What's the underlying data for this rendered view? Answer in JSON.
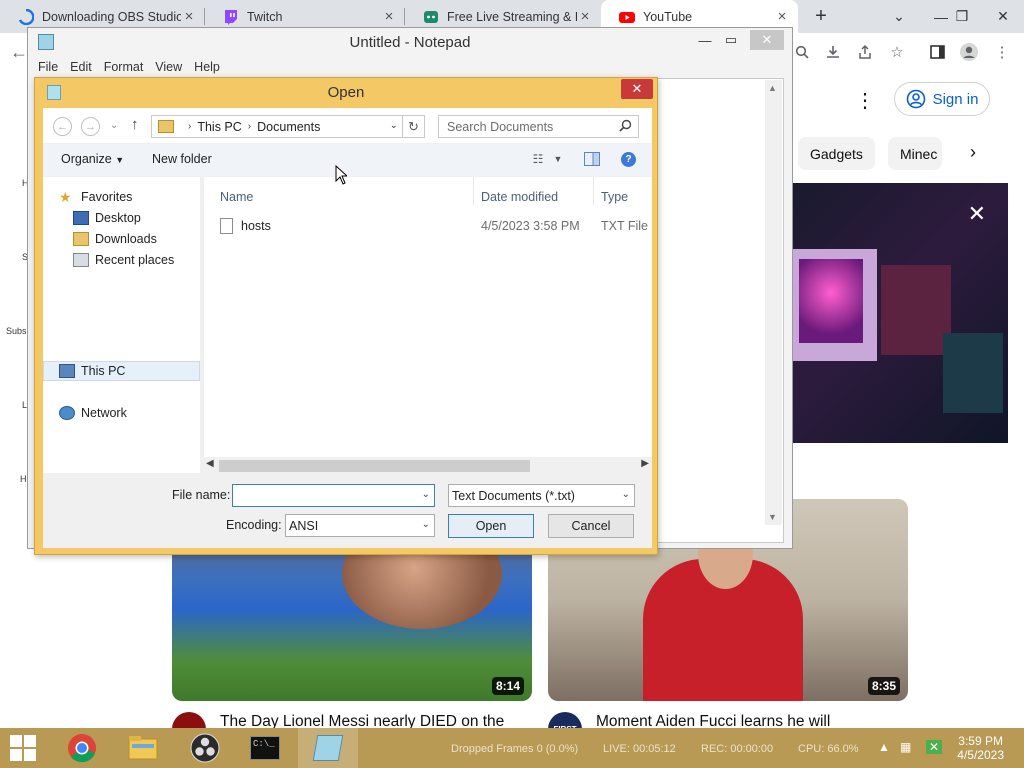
{
  "browser": {
    "tabs": [
      {
        "title": "Downloading OBS Studio",
        "close": "×"
      },
      {
        "title": "Twitch",
        "close": "×"
      },
      {
        "title": "Free Live Streaming & Re",
        "close": "×"
      },
      {
        "title": "YouTube",
        "close": "×"
      }
    ],
    "new_tab": "+",
    "tab_search": "⌄",
    "minimize": "—",
    "restore": "❐",
    "close": "✕"
  },
  "youtube": {
    "sign_in": "Sign in",
    "chips": [
      "Gadgets",
      "Minec"
    ],
    "sidebar_fragments": [
      "H",
      "S",
      "Subs",
      "L",
      "H"
    ],
    "videos": [
      {
        "title": "The Day Lionel Messi nearly DIED on the",
        "duration": "8:14"
      },
      {
        "title": "Moment Aiden Fucci learns he will",
        "duration": "8:35",
        "channel_badge": "FIRST"
      }
    ]
  },
  "notepad": {
    "title": "Untitled - Notepad",
    "menu": [
      "File",
      "Edit",
      "Format",
      "View",
      "Help"
    ]
  },
  "dialog": {
    "title": "Open",
    "breadcrumb": [
      "This PC",
      "Documents"
    ],
    "search_placeholder": "Search Documents",
    "organize": "Organize",
    "new_folder": "New folder",
    "nav": {
      "favorites": "Favorites",
      "desktop": "Desktop",
      "downloads": "Downloads",
      "recent": "Recent places",
      "this_pc": "This PC",
      "network": "Network"
    },
    "columns": {
      "name": "Name",
      "date": "Date modified",
      "type": "Type"
    },
    "files": [
      {
        "name": "hosts",
        "date": "4/5/2023 3:58 PM",
        "type": "TXT File"
      }
    ],
    "file_name_label": "File name:",
    "file_name_value": "",
    "file_type": "Text Documents (*.txt)",
    "encoding_label": "Encoding:",
    "encoding_value": "ANSI",
    "open": "Open",
    "cancel": "Cancel"
  },
  "taskbar": {
    "obs_status": {
      "dropped": "Dropped Frames 0 (0.0%)",
      "live": "LIVE: 00:05:12",
      "rec": "REC: 00:00:00",
      "cpu": "CPU: 66.0%"
    },
    "time": "3:59 PM",
    "date": "4/5/2023"
  },
  "colors": {
    "dialog_frame": "#f5c866",
    "taskbar": "#b89a54",
    "dialog_close": "#c8393a",
    "yt_link": "#065fd4"
  }
}
